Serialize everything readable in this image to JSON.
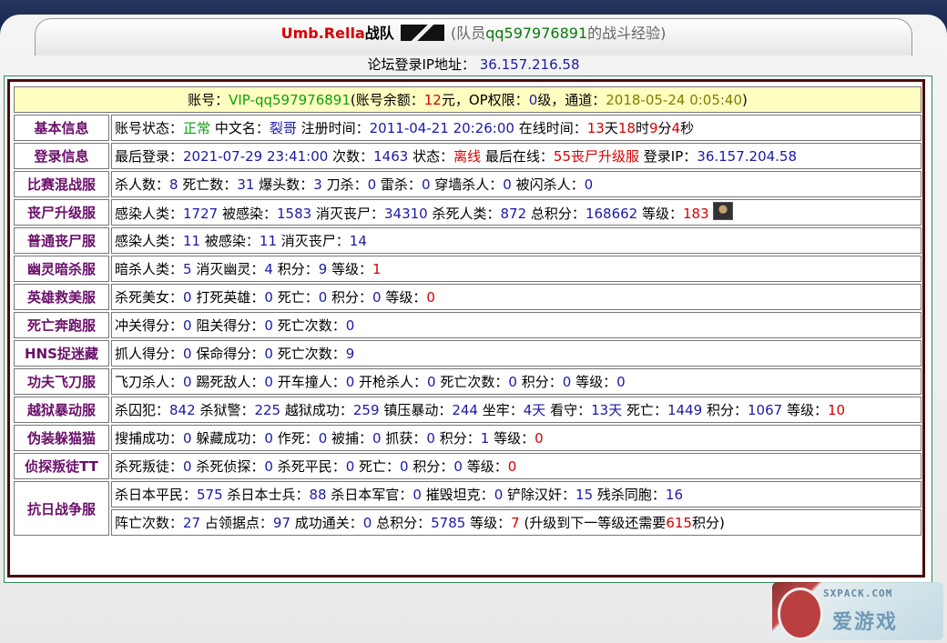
{
  "header": {
    "team_name": "Umb.Rella",
    "team_suffix": "战队",
    "member_prefix": "(队员",
    "member_name": "qq597976891",
    "member_suffix": "的战斗经验)",
    "ip_label": "论坛登录IP地址：",
    "ip_value": "36.157.216.58"
  },
  "account": {
    "label": "账号：",
    "id": "VIP-qq597976891",
    "balance_label": "(账号余额：",
    "balance": "12",
    "balance_unit": "元，OP权限：",
    "op_level": "0",
    "op_unit": "级，通道：",
    "channel_time": "2018-05-24 0:05:40",
    "close": ")"
  },
  "rows": {
    "basic": {
      "label": "基本信息",
      "status_label": "账号状态：",
      "status": "正常",
      "cn_label": "中文名：",
      "cn_name": "裂哥",
      "reg_label": "注册时间：",
      "reg_time": "2011-04-21 20:26:00",
      "online_label": "在线时间：",
      "days": "13",
      "days_u": "天",
      "hours": "18",
      "hours_u": "时",
      "mins": "9",
      "mins_u": "分",
      "secs": "4",
      "secs_u": "秒"
    },
    "login": {
      "label": "登录信息",
      "last_label": "最后登录：",
      "last": "2021-07-29 23:41:00",
      "count_label": "次数：",
      "count": "1463",
      "state_label": "状态：",
      "state": "离线",
      "last_online_label": "最后在线：",
      "last_online": "55丧尸升级服",
      "ip_label": "登录IP：",
      "ip": "36.157.204.58"
    },
    "match": {
      "label": "比赛混战服",
      "kills_l": "杀人数：",
      "kills": "8",
      "deaths_l": "死亡数：",
      "deaths": "31",
      "hs_l": "爆头数：",
      "hs": "3",
      "knife_l": "刀杀：",
      "knife": "0",
      "he_l": "雷杀：",
      "he": "0",
      "wall_l": "穿墙杀人：",
      "wall": "0",
      "flash_l": "被闪杀人：",
      "flash": "0"
    },
    "zombie_up": {
      "label": "丧尸升级服",
      "inf_l": "感染人类：",
      "inf": "1727",
      "infd_l": "被感染：",
      "infd": "1583",
      "destroy_l": "消灭丧尸：",
      "destroy": "34310",
      "killh_l": "杀死人类：",
      "killh": "872",
      "score_l": "总积分：",
      "score": "168662",
      "lvl_l": "等级：",
      "lvl": "183"
    },
    "zombie_normal": {
      "label": "普通丧尸服",
      "inf_l": "感染人类：",
      "inf": "11",
      "infd_l": "被感染：",
      "infd": "11",
      "destroy_l": "消灭丧尸：",
      "destroy": "14"
    },
    "ghost": {
      "label": "幽灵暗杀服",
      "assn_l": "暗杀人类：",
      "assn": "5",
      "dest_l": "消灭幽灵：",
      "dest": "4",
      "score_l": "积分：",
      "score": "9",
      "lvl_l": "等级：",
      "lvl": "1"
    },
    "hero": {
      "label": "英雄救美服",
      "kb_l": "杀死美女：",
      "kb": "0",
      "kh_l": "打死英雄：",
      "kh": "0",
      "d_l": "死亡：",
      "d": "0",
      "score_l": "积分：",
      "score": "0",
      "lvl_l": "等级：",
      "lvl": "0"
    },
    "deathrun": {
      "label": "死亡奔跑服",
      "pass_l": "冲关得分：",
      "pass": "0",
      "block_l": "阻关得分：",
      "block": "0",
      "d_l": "死亡次数：",
      "d": "0"
    },
    "hns": {
      "label": "HNS捉迷藏",
      "catch_l": "抓人得分：",
      "catch": "0",
      "save_l": "保命得分：",
      "save": "0",
      "d_l": "死亡次数：",
      "d": "9"
    },
    "kungfu": {
      "label": "功夫飞刀服",
      "fk_l": "飞刀杀人：",
      "fk": "0",
      "kick_l": "踢死敌人：",
      "kick": "0",
      "car_l": "开车撞人：",
      "car": "0",
      "gun_l": "开枪杀人：",
      "gun": "0",
      "d_l": "死亡次数：",
      "d": "0",
      "score_l": "积分：",
      "score": "0",
      "lvl_l": "等级：",
      "lvl": "0"
    },
    "jailbreak": {
      "label": "越狱暴动服",
      "kp_l": "杀囚犯：",
      "kp": "842",
      "kg_l": "杀狱警：",
      "kg": "225",
      "esc_l": "越狱成功：",
      "esc": "259",
      "riot_l": "镇压暴动：",
      "riot": "244",
      "jail_l": "坐牢：",
      "jail": "4天",
      "guard_l": "看守：",
      "guard": "13天",
      "d_l": "死亡：",
      "d": "1449",
      "score_l": "积分：",
      "score": "1067",
      "lvl_l": "等级：",
      "lvl": "10"
    },
    "prophunt": {
      "label": "伪装躲猫猫",
      "cap_l": "搜捕成功：",
      "cap": "0",
      "hide_l": "躲藏成功：",
      "hide": "0",
      "suicide_l": "作死：",
      "suicide": "0",
      "caught_l": "被捕：",
      "caught": "0",
      "grab_l": "抓获：",
      "grab": "0",
      "score_l": "积分：",
      "score": "1",
      "lvl_l": "等级：",
      "lvl": "0"
    },
    "detective": {
      "label": "侦探叛徒TT",
      "kt_l": "杀死叛徒：",
      "kt": "0",
      "kd_l": "杀死侦探：",
      "kd": "0",
      "kc_l": "杀死平民：",
      "kc": "0",
      "d_l": "死亡：",
      "d": "0",
      "score_l": "积分：",
      "score": "0",
      "lvl_l": "等级：",
      "lvl": "0"
    },
    "antijapan": {
      "label": "抗日战争服",
      "civ_l": "杀日本平民：",
      "civ": "575",
      "sol_l": "杀日本士兵：",
      "sol": "88",
      "off_l": "杀日本军官：",
      "off": "0",
      "tank_l": "摧毁坦克：",
      "tank": "0",
      "trait_l": "铲除汉奸：",
      "trait": "15",
      "tk_l": "残杀同胞：",
      "tk": "16",
      "d_l": "阵亡次数：",
      "d": "27",
      "base_l": "占领据点：",
      "base": "97",
      "clear_l": "成功通关：",
      "clear": "0",
      "score_l": "总积分：",
      "score": "5785",
      "lvl_l": "等级：",
      "lvl": "7",
      "next_pre": "(升级到下一等级还需要",
      "next_pts": "615",
      "next_suf": "积分)"
    }
  },
  "watermark": {
    "url": "SXPACK.COM",
    "text": "爱游戏"
  },
  "colors": {
    "label_purple": "#6a0f6a",
    "value_blue": "#1a1aa8",
    "value_red": "#d60000",
    "status_green": "#11a011",
    "header_yellow": "#fffec0",
    "border_brown": "#4b0a0a"
  }
}
